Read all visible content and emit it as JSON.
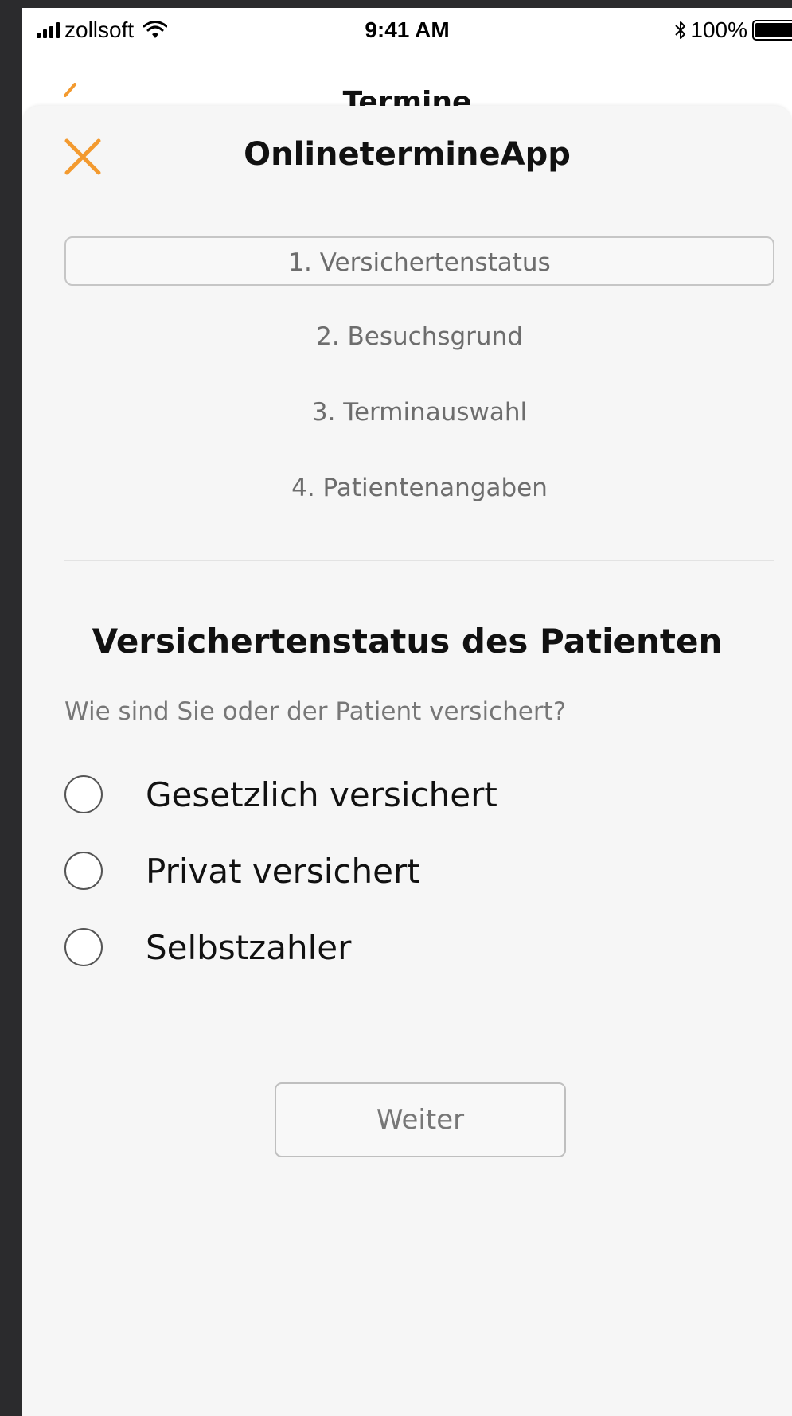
{
  "status_bar": {
    "carrier": "zollsoft",
    "time": "9:41 AM",
    "battery": "100%"
  },
  "background_nav": {
    "title": "Termine"
  },
  "sheet": {
    "title": "OnlinetermineApp",
    "steps": [
      {
        "label": "1. Versichertenstatus",
        "active": true
      },
      {
        "label": "2. Besuchsgrund",
        "active": false
      },
      {
        "label": "3. Terminauswahl",
        "active": false
      },
      {
        "label": "4. Patientenangaben",
        "active": false
      }
    ],
    "heading": "Versichertenstatus des Patienten",
    "question": "Wie sind Sie oder der Patient versichert?",
    "options": [
      {
        "label": "Gesetzlich versichert",
        "selected": false
      },
      {
        "label": "Privat versichert",
        "selected": false
      },
      {
        "label": "Selbstzahler",
        "selected": false
      }
    ],
    "next_label": "Weiter"
  },
  "colors": {
    "accent": "#f39a2f",
    "sheet_bg": "#f6f6f6",
    "frame_bg": "#2b2b2d"
  }
}
